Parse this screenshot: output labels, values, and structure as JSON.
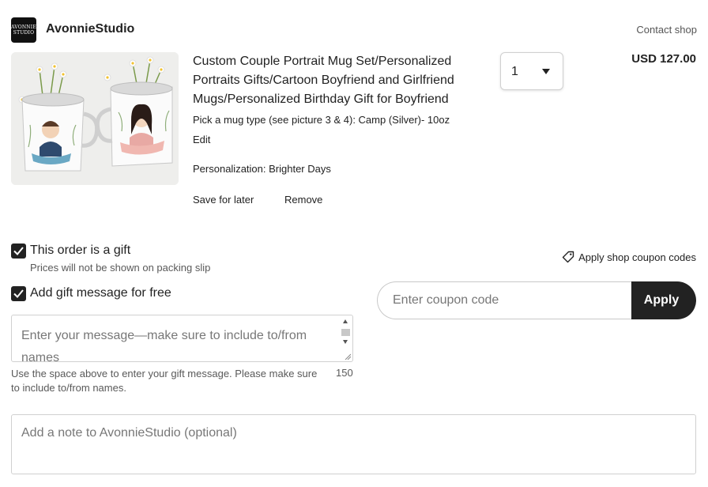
{
  "shop": {
    "logo_text_line1": "AVONNIE",
    "logo_text_line2": "STUDIO",
    "name": "AvonnieStudio",
    "contact_label": "Contact shop"
  },
  "item": {
    "title": "Custom Couple Portrait Mug Set/Personalized Portraits Gifts/Cartoon Boyfriend and Girlfriend Mugs/Personalized Birthday Gift for Boyfriend",
    "variation": "Pick a mug type (see picture 3 & 4): Camp (Silver)- 10oz",
    "edit_label": "Edit",
    "personalization": "Personalization: Brighter Days",
    "save_later_label": "Save for later",
    "remove_label": "Remove",
    "quantity": "1",
    "price": "USD 127.00",
    "image_icon": "product-photo-icon"
  },
  "gift": {
    "is_gift_label": "This order is a gift",
    "is_gift_checked": true,
    "is_gift_note": "Prices will not be shown on packing slip",
    "add_message_label": "Add gift message for free",
    "add_message_checked": true,
    "message_placeholder": "Enter your message—make sure to include to/from names",
    "message_helper": "Use the space above to enter your gift message. Please make sure to include to/from names.",
    "message_chars_left": "150"
  },
  "coupon": {
    "link_label": "Apply shop coupon codes",
    "link_icon": "tag-icon",
    "placeholder": "Enter coupon code",
    "apply_label": "Apply"
  },
  "note": {
    "placeholder": "Add a note to AvonnieStudio (optional)"
  },
  "colors": {
    "primary_button": "#222222",
    "checkbox": "#222222",
    "text": "#222222",
    "muted_text": "#595959",
    "border": "#d0d0d0"
  }
}
